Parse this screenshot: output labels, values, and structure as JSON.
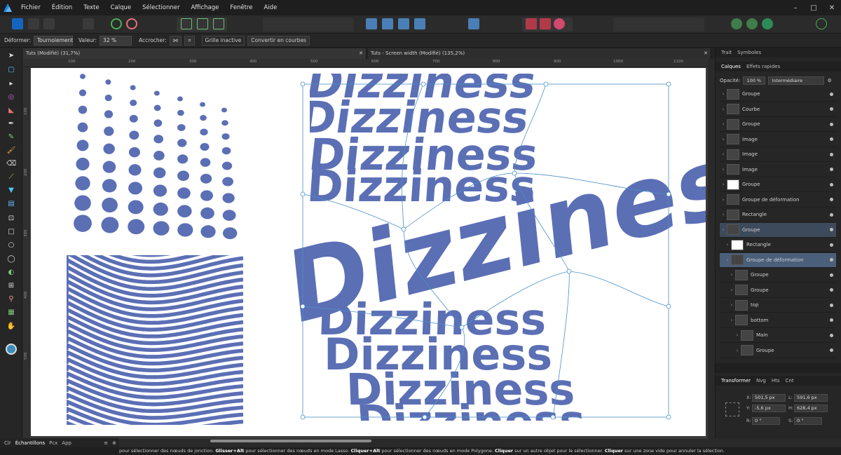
{
  "menu": [
    "Fichier",
    "Édition",
    "Texte",
    "Calque",
    "Sélectionner",
    "Affichage",
    "Fenêtre",
    "Aide"
  ],
  "context_bar": {
    "deformer_label": "Déformer:",
    "deformer_value": "Tournoiement",
    "valeur_label": "Valeur:",
    "valeur_value": "32 %",
    "accrocher_label": "Accrocher:",
    "grille_label": "Grille inactive",
    "convert_label": "Convertir en courbes"
  },
  "tabs": [
    {
      "label": "Tuts (Modifié) (31,7%)"
    },
    {
      "label": "Tuts - Screen width (Modifié) (135,2%)"
    }
  ],
  "ruler_h": [
    "100",
    "200",
    "300",
    "400",
    "500",
    "600",
    "700",
    "800",
    "900",
    "1000",
    "1100"
  ],
  "ruler_v": [
    "100",
    "200",
    "300",
    "400",
    "500"
  ],
  "artwork": {
    "word": "Dizziness",
    "fill_color": "#5b6fb5"
  },
  "right_panel": {
    "top_tabs": [
      "Trait",
      "Symboles"
    ],
    "layer_tabs": [
      "Calques",
      "Effets rapides"
    ],
    "opacity_label": "Opacité:",
    "opacity_value": "100 %",
    "blend_mode": "Intermédiaire",
    "layers": [
      {
        "name": "Groupe"
      },
      {
        "name": "Courbe"
      },
      {
        "name": "Groupe"
      },
      {
        "name": "Image"
      },
      {
        "name": "Image"
      },
      {
        "name": "Image"
      },
      {
        "name": "Groupe"
      },
      {
        "name": "Groupe de déformation"
      },
      {
        "name": "Rectangle"
      },
      {
        "name": "Groupe"
      },
      {
        "name": "Rectangle"
      },
      {
        "name": "Groupe de déformation"
      },
      {
        "name": "Groupe"
      },
      {
        "name": "Groupe"
      },
      {
        "name": "top"
      },
      {
        "name": "bottom"
      },
      {
        "name": "Main"
      },
      {
        "name": "Groupe"
      }
    ],
    "transform_tabs": [
      "Transformer",
      "Nvg",
      "Hts",
      "Cnt"
    ],
    "transform": {
      "x_label": "X:",
      "x_value": "501,5 px",
      "y_label": "Y:",
      "y_value": "-5,6 px",
      "l_label": "L:",
      "l_value": "591,6 px",
      "h_label": "H:",
      "h_value": "628,4 px",
      "r_label": "R:",
      "r_value": "0 °",
      "s_label": "S:",
      "s_value": "0 °"
    }
  },
  "bottom_panel_tabs": [
    "Clr",
    "Échantillons",
    "Pcx",
    "App"
  ],
  "status": {
    "part1": " pour sélectionner des nœuds de jonction. ",
    "b1": "Glisser+Alt",
    "part2": " pour sélectionner des nœuds en mode Lasso. ",
    "b2": "Cliquer+Alt",
    "part3": " pour sélectionner des nœuds en mode Polygone. ",
    "b3": "Cliquer",
    "part4": " sur un autre objet pour le sélectionner. ",
    "b4": "Cliquer",
    "part5": " sur une zone vide pour annuler la sélection."
  }
}
